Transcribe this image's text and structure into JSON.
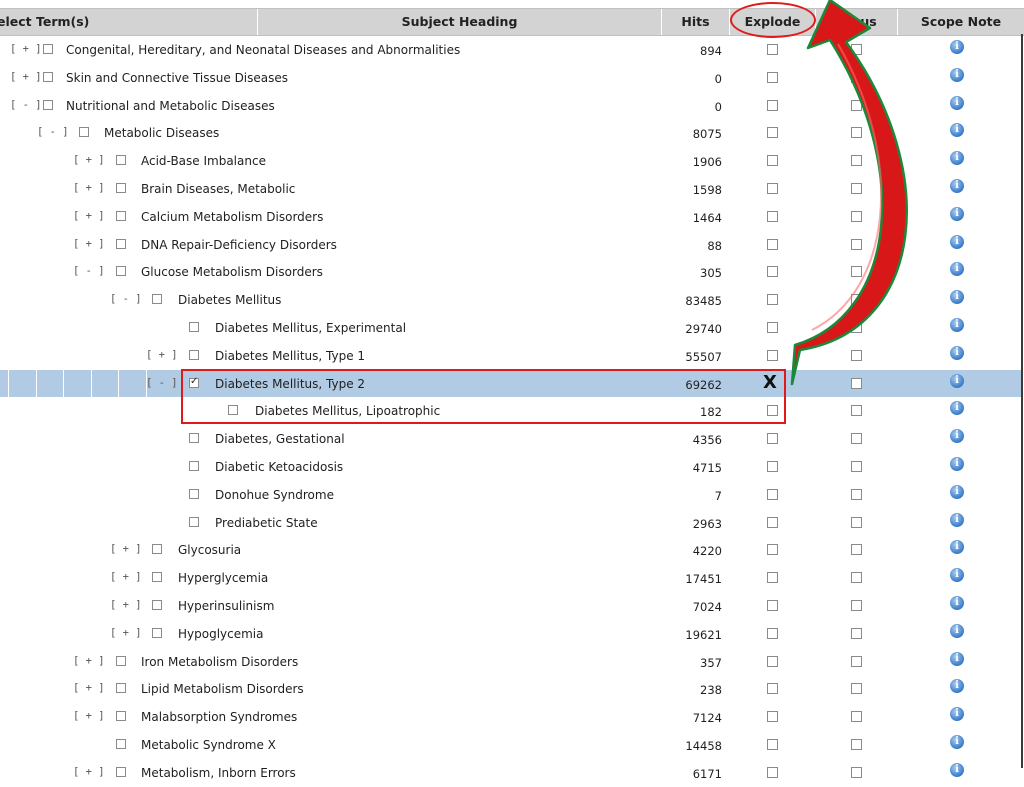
{
  "header": {
    "select": "Select Term(s)",
    "subject": "Subject Heading",
    "hits": "Hits",
    "explode": "Explode",
    "focus": "Focus",
    "scope": "Scope Note"
  },
  "rows": [
    {
      "toggle": "[+]",
      "label": "Congenital, Hereditary, and Neonatal Diseases and Abnormalities",
      "hits": "894"
    },
    {
      "toggle": "[+]",
      "label": "Skin and Connective Tissue Diseases",
      "hits": "0"
    },
    {
      "toggle": "[-]",
      "label": "Nutritional and Metabolic Diseases",
      "hits": "0"
    },
    {
      "toggle": "[-]",
      "label": "Metabolic Diseases",
      "hits": "8075"
    },
    {
      "toggle": "[+]",
      "label": "Acid-Base Imbalance",
      "hits": "1906"
    },
    {
      "toggle": "[+]",
      "label": "Brain Diseases, Metabolic",
      "hits": "1598"
    },
    {
      "toggle": "[+]",
      "label": "Calcium Metabolism Disorders",
      "hits": "1464"
    },
    {
      "toggle": "[+]",
      "label": "DNA Repair-Deficiency Disorders",
      "hits": "88"
    },
    {
      "toggle": "[-]",
      "label": "Glucose Metabolism Disorders",
      "hits": "305"
    },
    {
      "toggle": "[-]",
      "label": "Diabetes Mellitus",
      "hits": "83485"
    },
    {
      "toggle": "",
      "label": "Diabetes Mellitus, Experimental",
      "hits": "29740"
    },
    {
      "toggle": "[+]",
      "label": "Diabetes Mellitus, Type 1",
      "hits": "55507"
    },
    {
      "toggle": "[-]",
      "label": "Diabetes Mellitus, Type 2",
      "hits": "69262",
      "selected": true,
      "select_checked": true
    },
    {
      "toggle": "",
      "label": "Diabetes Mellitus, Lipoatrophic",
      "hits": "182"
    },
    {
      "toggle": "",
      "label": "Diabetes, Gestational",
      "hits": "4356"
    },
    {
      "toggle": "",
      "label": "Diabetic Ketoacidosis",
      "hits": "4715"
    },
    {
      "toggle": "",
      "label": "Donohue Syndrome",
      "hits": "7"
    },
    {
      "toggle": "",
      "label": "Prediabetic State",
      "hits": "2963"
    },
    {
      "toggle": "[+]",
      "label": "Glycosuria",
      "hits": "4220"
    },
    {
      "toggle": "[+]",
      "label": "Hyperglycemia",
      "hits": "17451"
    },
    {
      "toggle": "[+]",
      "label": "Hyperinsulinism",
      "hits": "7024"
    },
    {
      "toggle": "[+]",
      "label": "Hypoglycemia",
      "hits": "19621"
    },
    {
      "toggle": "[+]",
      "label": "Iron Metabolism Disorders",
      "hits": "357"
    },
    {
      "toggle": "[+]",
      "label": "Lipid Metabolism Disorders",
      "hits": "238"
    },
    {
      "toggle": "[+]",
      "label": "Malabsorption Syndromes",
      "hits": "7124"
    },
    {
      "toggle": "",
      "label": "Metabolic Syndrome X",
      "hits": "14458"
    },
    {
      "toggle": "[+]",
      "label": "Metabolism, Inborn Errors",
      "hits": "6171"
    }
  ],
  "explode_mark": "X",
  "info_glyph": "i",
  "colors": {
    "header_bg": "#d3d3d3",
    "selected_row": "#b0cbe3",
    "highlight_red": "#e01a1a",
    "arrow_green": "#1a8a3a",
    "info_blue": "#3f7fcb"
  },
  "icons": [
    "expand-collapse-toggle",
    "checkbox-icon",
    "info-icon",
    "curved-arrow-icon",
    "x-mark-icon"
  ]
}
